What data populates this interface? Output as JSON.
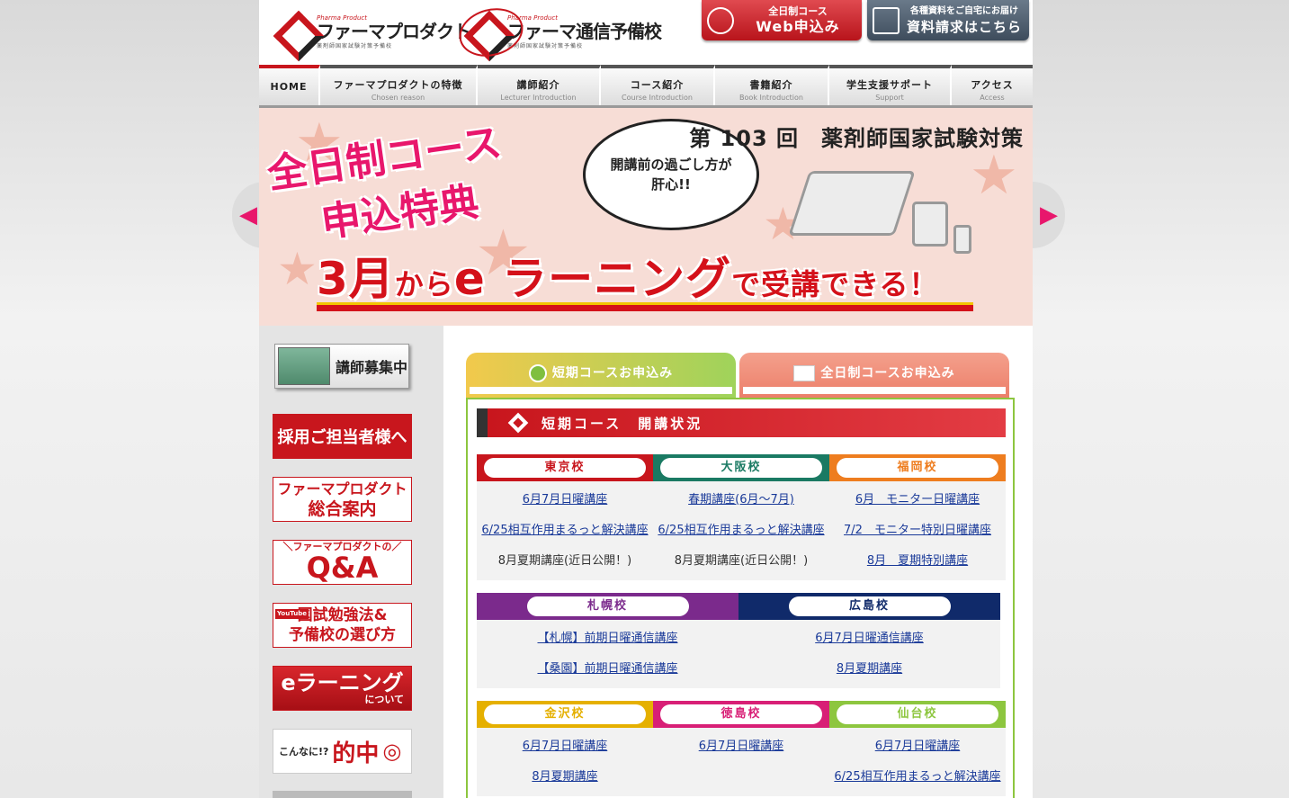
{
  "header": {
    "logo1": {
      "small": "Pharma Product",
      "name": "ファーマプロダクト",
      "sub": "薬剤師国家試験対策予備校"
    },
    "logo2": {
      "small": "Pharma Product",
      "name": "ファーマ通信予備校",
      "sub": "薬剤師国家試験対策予備校"
    },
    "web_apply": {
      "line1": "全日制コース",
      "line2": "Web申込み"
    },
    "material": {
      "line1": "各種資料をご自宅にお届け",
      "line2": "資料請求はこちら"
    }
  },
  "nav": [
    {
      "jp": "HOME",
      "en": ""
    },
    {
      "jp": "ファーマプロダクトの特徴",
      "en": "Chosen reason"
    },
    {
      "jp": "講師紹介",
      "en": "Lecturer Introduction"
    },
    {
      "jp": "コース紹介",
      "en": "Course Introduction"
    },
    {
      "jp": "書籍紹介",
      "en": "Book Introduction"
    },
    {
      "jp": "学生支援サポート",
      "en": "Support"
    },
    {
      "jp": "アクセス",
      "en": "Access"
    }
  ],
  "banner": {
    "title1": "全日制コース",
    "title2": "申込特典",
    "bubble_line1": "開講前の過ごし方が",
    "bubble_line2": "肝心!!",
    "exam": "第 103 回　薬剤師国家試験対策",
    "main_a": "3月",
    "main_b": "から",
    "main_c": "e ラーニング",
    "main_d": "で受講できる！"
  },
  "sidebar": {
    "recruit": "講師募集中",
    "hr": "採用ご担当者様へ",
    "guide_line1": "ファーマプロダクト",
    "guide_line2": "総合案内",
    "qa_line1": "＼ファーマプロダクトの／",
    "qa_line2": "Q&A",
    "youtube_line1": "国試勉強法&",
    "youtube_line2": "予備校の選び方",
    "youtube_tag": "YouTube",
    "elearning_line1": "eラーニング",
    "elearning_line2": "について",
    "hit_line1": "こんなに!?",
    "hit_line2": "的中"
  },
  "tabs": {
    "short": "短期コースお申込み",
    "full": "全日制コースお申込み"
  },
  "panel": {
    "title": "短期コース　開講状況",
    "group1": {
      "heads": [
        "東京校",
        "大阪校",
        "福岡校"
      ],
      "colors": [
        "#c8161d",
        "#1a7a63",
        "#ee7d1f"
      ],
      "cols": [
        [
          {
            "t": "6月7月日曜講座",
            "link": true
          },
          {
            "t": "6/25相互作用まるっと解決講座",
            "link": true
          },
          {
            "t": "8月夏期講座(近日公開！)",
            "link": false
          }
        ],
        [
          {
            "t": "春期講座(6月～7月)",
            "link": true
          },
          {
            "t": "6/25相互作用まるっと解決講座",
            "link": true
          },
          {
            "t": "8月夏期講座(近日公開！)",
            "link": false
          }
        ],
        [
          {
            "t": "6月　モニター日曜講座",
            "link": true
          },
          {
            "t": "7/2　モニター特別日曜講座",
            "link": true
          },
          {
            "t": "8月　夏期特別講座",
            "link": true
          }
        ]
      ]
    },
    "group2": {
      "heads": [
        "札幌校",
        "広島校"
      ],
      "colors": [
        "#7b2a8c",
        "#102a6a"
      ],
      "cols": [
        [
          {
            "t": "【札幌】前期日曜通信講座",
            "link": true
          },
          {
            "t": "【桑園】前期日曜通信講座",
            "link": true
          }
        ],
        [
          {
            "t": "6月7月日曜通信講座",
            "link": true
          },
          {
            "t": "8月夏期講座",
            "link": true
          }
        ]
      ]
    },
    "group3": {
      "heads": [
        "金沢校",
        "徳島校",
        "仙台校"
      ],
      "colors": [
        "#e5b000",
        "#d81f76",
        "#8dc63f"
      ],
      "cols": [
        [
          {
            "t": "6月7月日曜講座",
            "link": true
          },
          {
            "t": "8月夏期講座",
            "link": true
          }
        ],
        [
          {
            "t": "6月7月日曜講座",
            "link": true
          }
        ],
        [
          {
            "t": "6月7月日曜講座",
            "link": true
          },
          {
            "t": "6/25相互作用まるっと解決講座",
            "link": true
          }
        ]
      ]
    }
  }
}
